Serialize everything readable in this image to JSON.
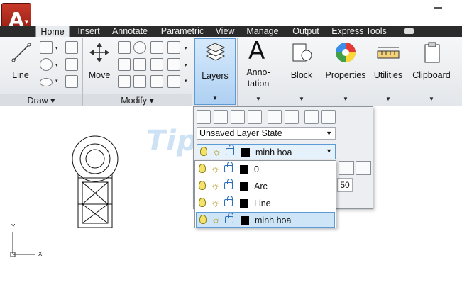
{
  "app": {
    "logo_letter": "A"
  },
  "tabs": [
    "Home",
    "Insert",
    "Annotate",
    "Parametric",
    "View",
    "Manage",
    "Output",
    "Express Tools"
  ],
  "ribbon": {
    "draw": {
      "line_label": "Line",
      "panel_title": "Draw ▾"
    },
    "modify": {
      "move_label": "Move",
      "panel_title": "Modify ▾"
    },
    "layers": {
      "label": "Layers"
    },
    "annotation": {
      "label_line1": "Anno-",
      "label_line2": "tation"
    },
    "block": {
      "label": "Block"
    },
    "properties": {
      "label": "Properties"
    },
    "utilities": {
      "label": "Utilities"
    },
    "clipboard": {
      "label": "Clipboard"
    }
  },
  "layer_panel": {
    "state_value": "Unsaved Layer State",
    "current_layer": "minh hoa",
    "side_value": "50"
  },
  "layer_list": [
    {
      "name": "0",
      "selected": false
    },
    {
      "name": "Arc",
      "selected": false
    },
    {
      "name": "Line",
      "selected": false
    },
    {
      "name": "minh hoa",
      "selected": true
    }
  ],
  "ucs": {
    "x_label": "X",
    "y_label": "Y"
  },
  "watermark": "TipsMake",
  "colors": {
    "accent": "#5d9bd6",
    "tab_bar": "#2b2b2b",
    "app_red": "#b02a1c"
  }
}
